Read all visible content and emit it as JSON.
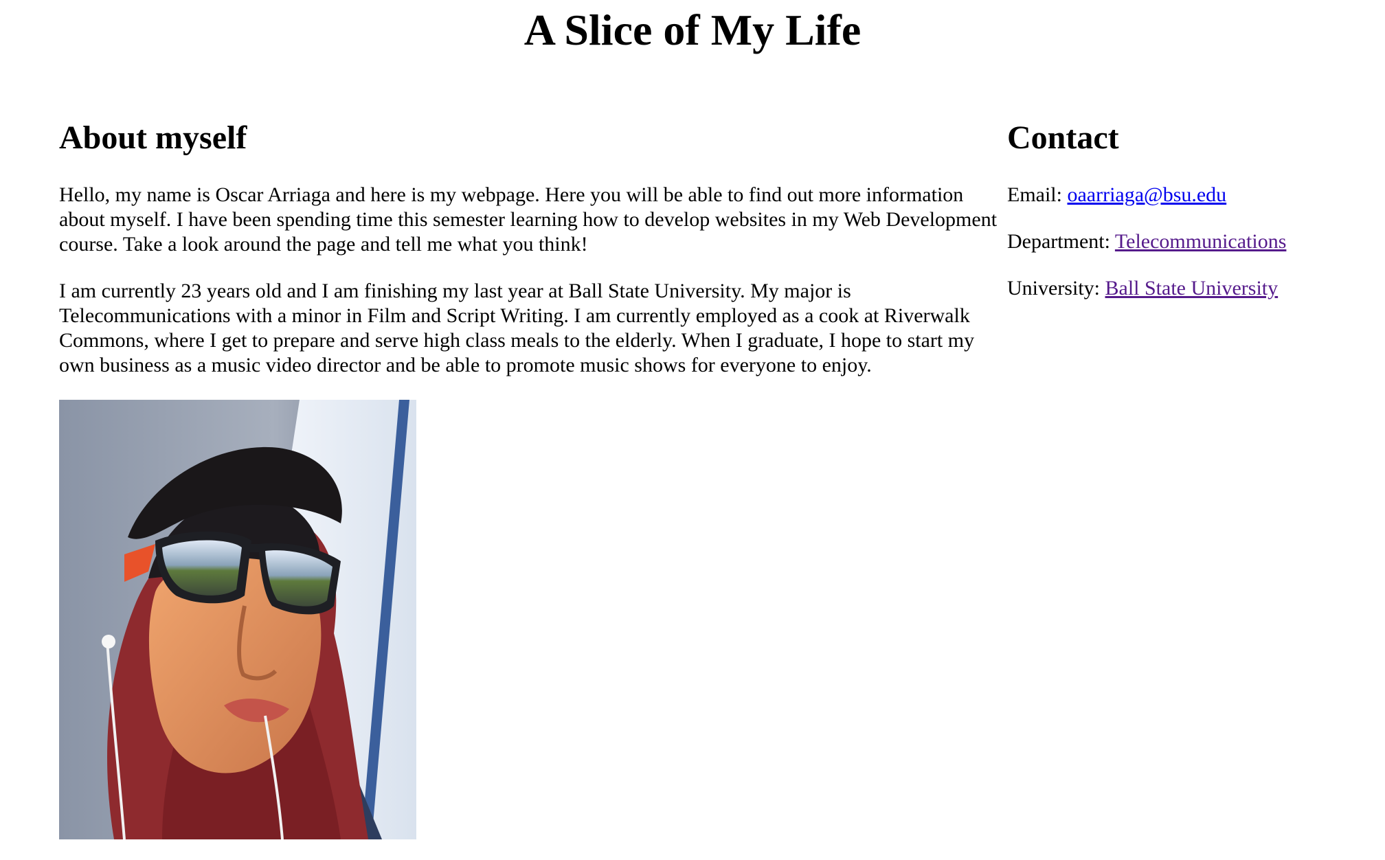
{
  "page": {
    "title": "A Slice of My Life"
  },
  "about": {
    "heading": "About myself",
    "paragraphs": [
      "Hello, my name is Oscar Arriaga and here is my webpage. Here you will be able to find out more information about myself. I have been spending time this semester learning how to develop websites in my Web Development course. Take a look around the page and tell me what you think!",
      "I am currently 23 years old and I am finishing my last year at Ball State University. My major is Telecommunications with a minor in Film and Script Writing. I am currently employed as a cook at Riverwalk Commons, where I get to prepare and serve high class meals to the elderly. When I graduate, I hope to start my own business as a music video director and be able to promote music shows for everyone to enjoy."
    ]
  },
  "contact": {
    "heading": "Contact",
    "email_label": "Email: ",
    "email_link": "oaarriaga@bsu.edu",
    "department_label": "Department: ",
    "department_link": "Telecommunications",
    "university_label": "University: ",
    "university_link": "Ball State University"
  },
  "colors": {
    "link_unvisited": "#0000ee",
    "link_visited": "#551a8b"
  }
}
